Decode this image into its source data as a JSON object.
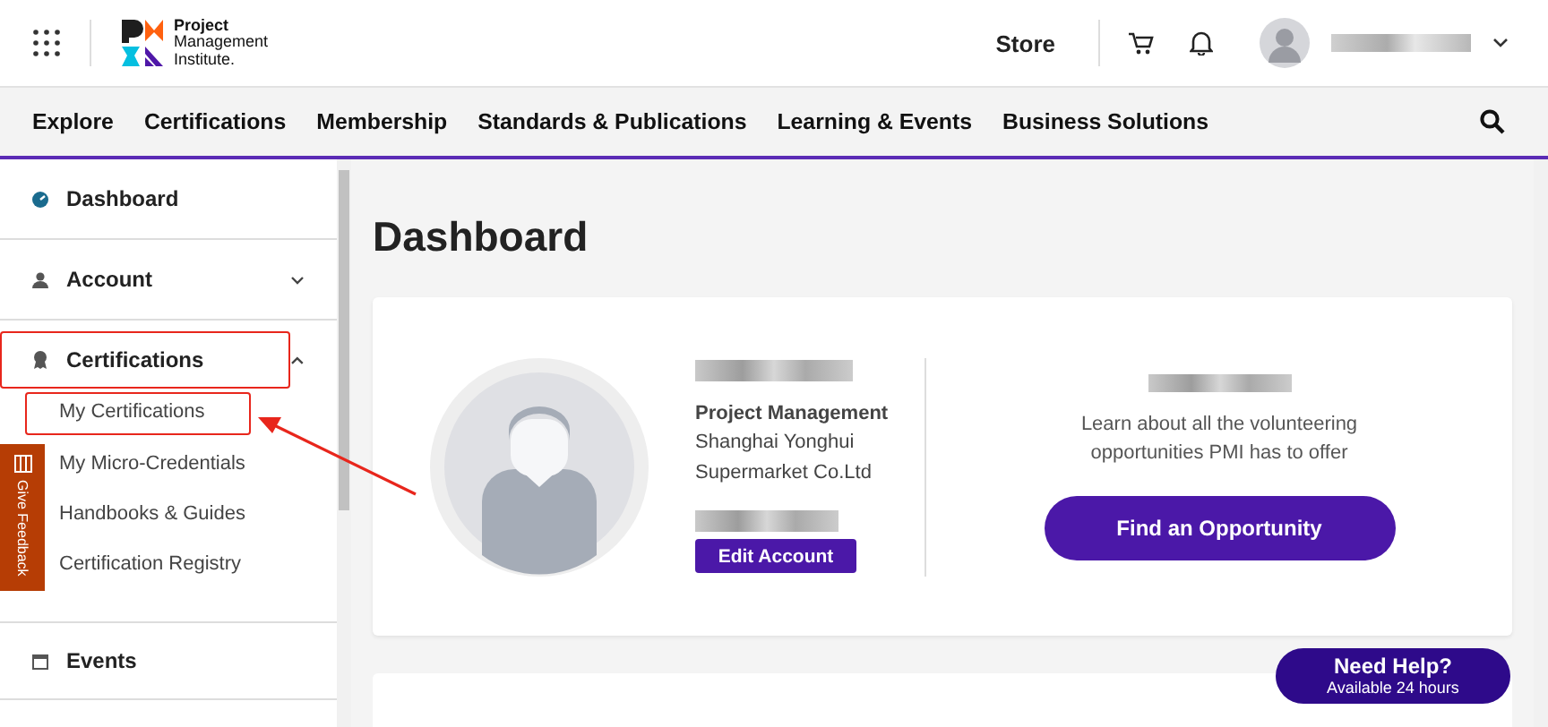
{
  "header": {
    "logo_text": [
      "Project",
      "Management",
      "Institute."
    ],
    "store": "Store"
  },
  "nav": {
    "items": [
      "Explore",
      "Certifications",
      "Membership",
      "Standards & Publications",
      "Learning & Events",
      "Business Solutions"
    ]
  },
  "sidebar": {
    "items": [
      {
        "label": "Dashboard",
        "highlighted": false
      },
      {
        "label": "Account",
        "expanded": false,
        "highlighted": false
      },
      {
        "label": "Certifications",
        "expanded": true,
        "highlighted": true,
        "children": [
          {
            "label": "My Certifications",
            "highlighted": true
          },
          {
            "label": "My Micro-Credentials",
            "highlighted": false
          },
          {
            "label": "Handbooks & Guides",
            "highlighted": false
          },
          {
            "label": "Certification Registry",
            "highlighted": false
          }
        ]
      },
      {
        "label": "Events",
        "highlighted": false
      }
    ]
  },
  "feedback_tab": {
    "label": "Give Feedback"
  },
  "main": {
    "title": "Dashboard",
    "profile": {
      "role": "Project Management",
      "company_lines": [
        "Shanghai Yonghui",
        "Supermarket Co.Ltd"
      ],
      "button": "Edit Account"
    },
    "volunteer": {
      "text_lines": [
        "Learn about all the volunteering",
        "opportunities PMI has to offer"
      ],
      "button": "Find an Opportunity"
    }
  },
  "help": {
    "title": "Need Help?",
    "subtitle": "Available 24 hours"
  }
}
